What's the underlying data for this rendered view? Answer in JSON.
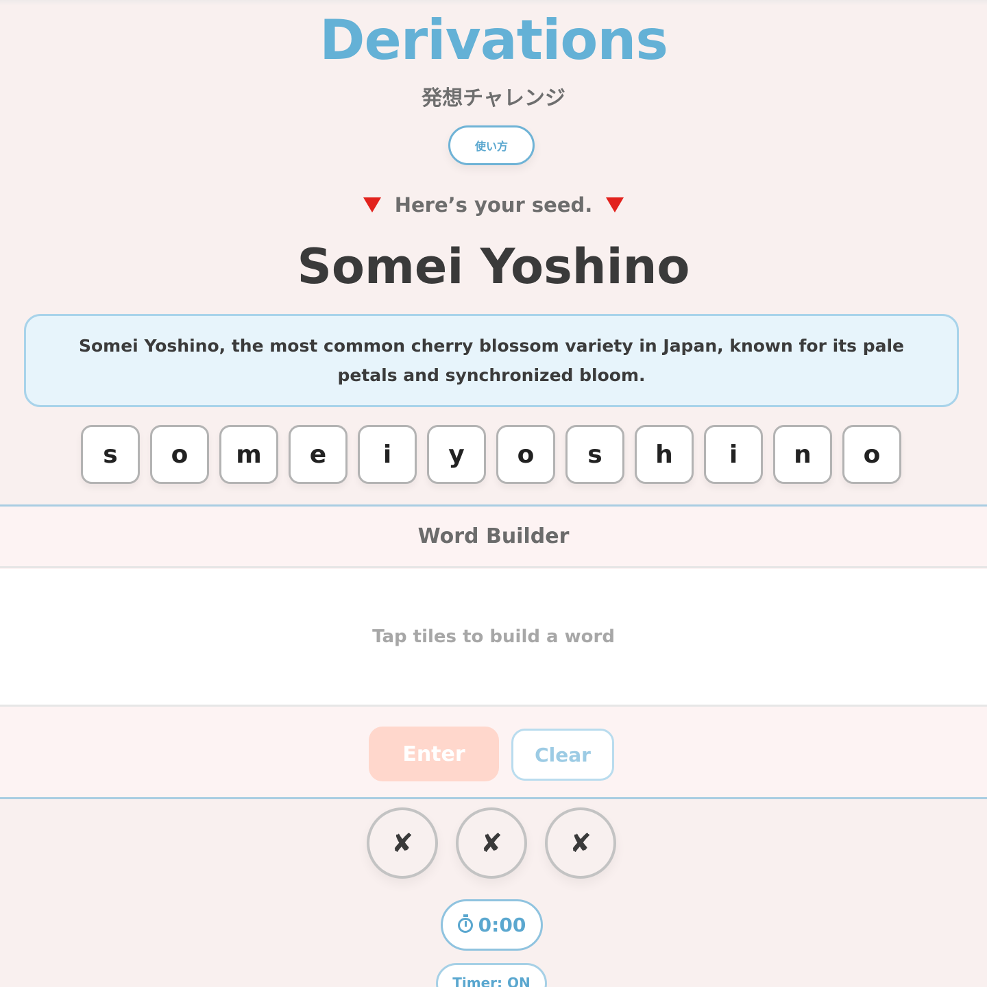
{
  "header": {
    "title": "Derivations",
    "subtitle": "発想チャレンジ",
    "how_to_label": "使い方"
  },
  "seed": {
    "prompt": "Here’s your seed.",
    "word": "Somei Yoshino",
    "definition": "Somei Yoshino, the most common cherry blossom variety in Japan, known for its pale petals and synchronized bloom."
  },
  "tiles": [
    "s",
    "o",
    "m",
    "e",
    "i",
    "y",
    "o",
    "s",
    "h",
    "i",
    "n",
    "o"
  ],
  "builder": {
    "heading": "Word Builder",
    "placeholder": "Tap tiles to build a word",
    "enter_label": "Enter",
    "clear_label": "Clear"
  },
  "strikes": [
    "✘",
    "✘",
    "✘"
  ],
  "timer": {
    "value": "0:00",
    "toggle_label": "Timer: ON"
  },
  "colors": {
    "background": "#f9f0ef",
    "accent_blue": "#64b1d6",
    "enter_disabled": "#ffd7cc",
    "definition_bg": "#e7f4fb",
    "marker_red": "#e2221d"
  },
  "icons": {
    "seed_marker": "red-down-triangle",
    "timer": "stopwatch-icon",
    "strike": "cross-mark"
  }
}
